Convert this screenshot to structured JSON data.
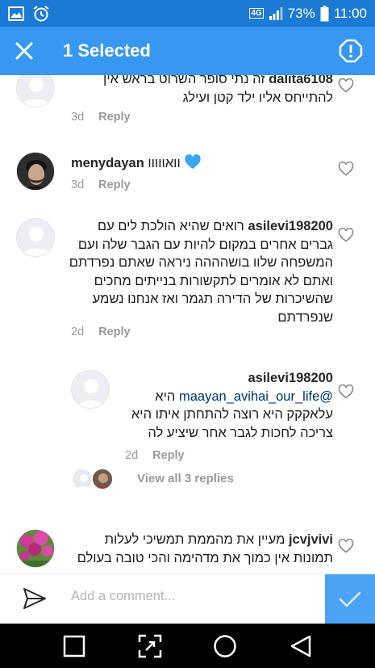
{
  "statusbar": {
    "battery_percent": "73%",
    "time": "11:00",
    "network": "4G",
    "icons": [
      "image-icon",
      "alarm-icon",
      "signal-icon",
      "battery-icon"
    ]
  },
  "actionbar": {
    "title": "1 Selected",
    "close_icon": "close-icon",
    "report_icon": "report-icon"
  },
  "comments": [
    {
      "username": "dalita6108",
      "text": "זה נתי סופר השרוט בראש אין להתייחס אליו ילד קטן ועילג",
      "time": "3d",
      "reply": "Reply",
      "avatar": "default"
    },
    {
      "username": "menydayan",
      "text": "וואווווו",
      "emoji": "blue-heart-icon",
      "time": "3d",
      "reply": "Reply",
      "avatar": "photo"
    },
    {
      "username": "asilevi198200",
      "text": "רואים שהיא הולכת לים עם גברים אחרים במקום להיות עם הגבר שלה ועם המשפחה שלוו בושהההה ניראה שאתם נפרדתם ואתם לא אומרים לתקשורות בנייתים מחכים שהשיכרות של הדירה תגמר ואז אנחנו נשמע שנפרדתם",
      "time": "2d",
      "reply": "Reply",
      "avatar": "default"
    },
    {
      "username": "asilevi198200",
      "mention": "@maayan_avihai_our_life",
      "text": "היא עלאקקק היא רוצה להתחתן איתו היא צריכה לחכות לגבר אחר שיציע לה",
      "time": "2d",
      "reply": "Reply",
      "avatar": "default",
      "is_reply": true
    },
    {
      "username": "jcvjvivi",
      "text": "מעיין את מהממת תמשיכי לעלות תמונות אין כמוך את מדהימה והכי טובה בעולם",
      "time": "",
      "reply": "",
      "avatar": "flowers"
    }
  ],
  "view_replies": "View all 3 replies",
  "composer": {
    "placeholder": "Add a comment...",
    "send_icon": "send-icon",
    "post_icon": "checkmark-icon"
  },
  "navbar": {
    "icons": [
      "recents-square-icon",
      "screenshot-expand-icon",
      "home-circle-icon",
      "back-triangle-icon"
    ]
  },
  "colors": {
    "accent": "#3897f0",
    "statusbar": "#1b7ad3",
    "secondary_text": "#9a9a9a",
    "link": "#003569",
    "heart_emoji": "#3aa5f0"
  }
}
